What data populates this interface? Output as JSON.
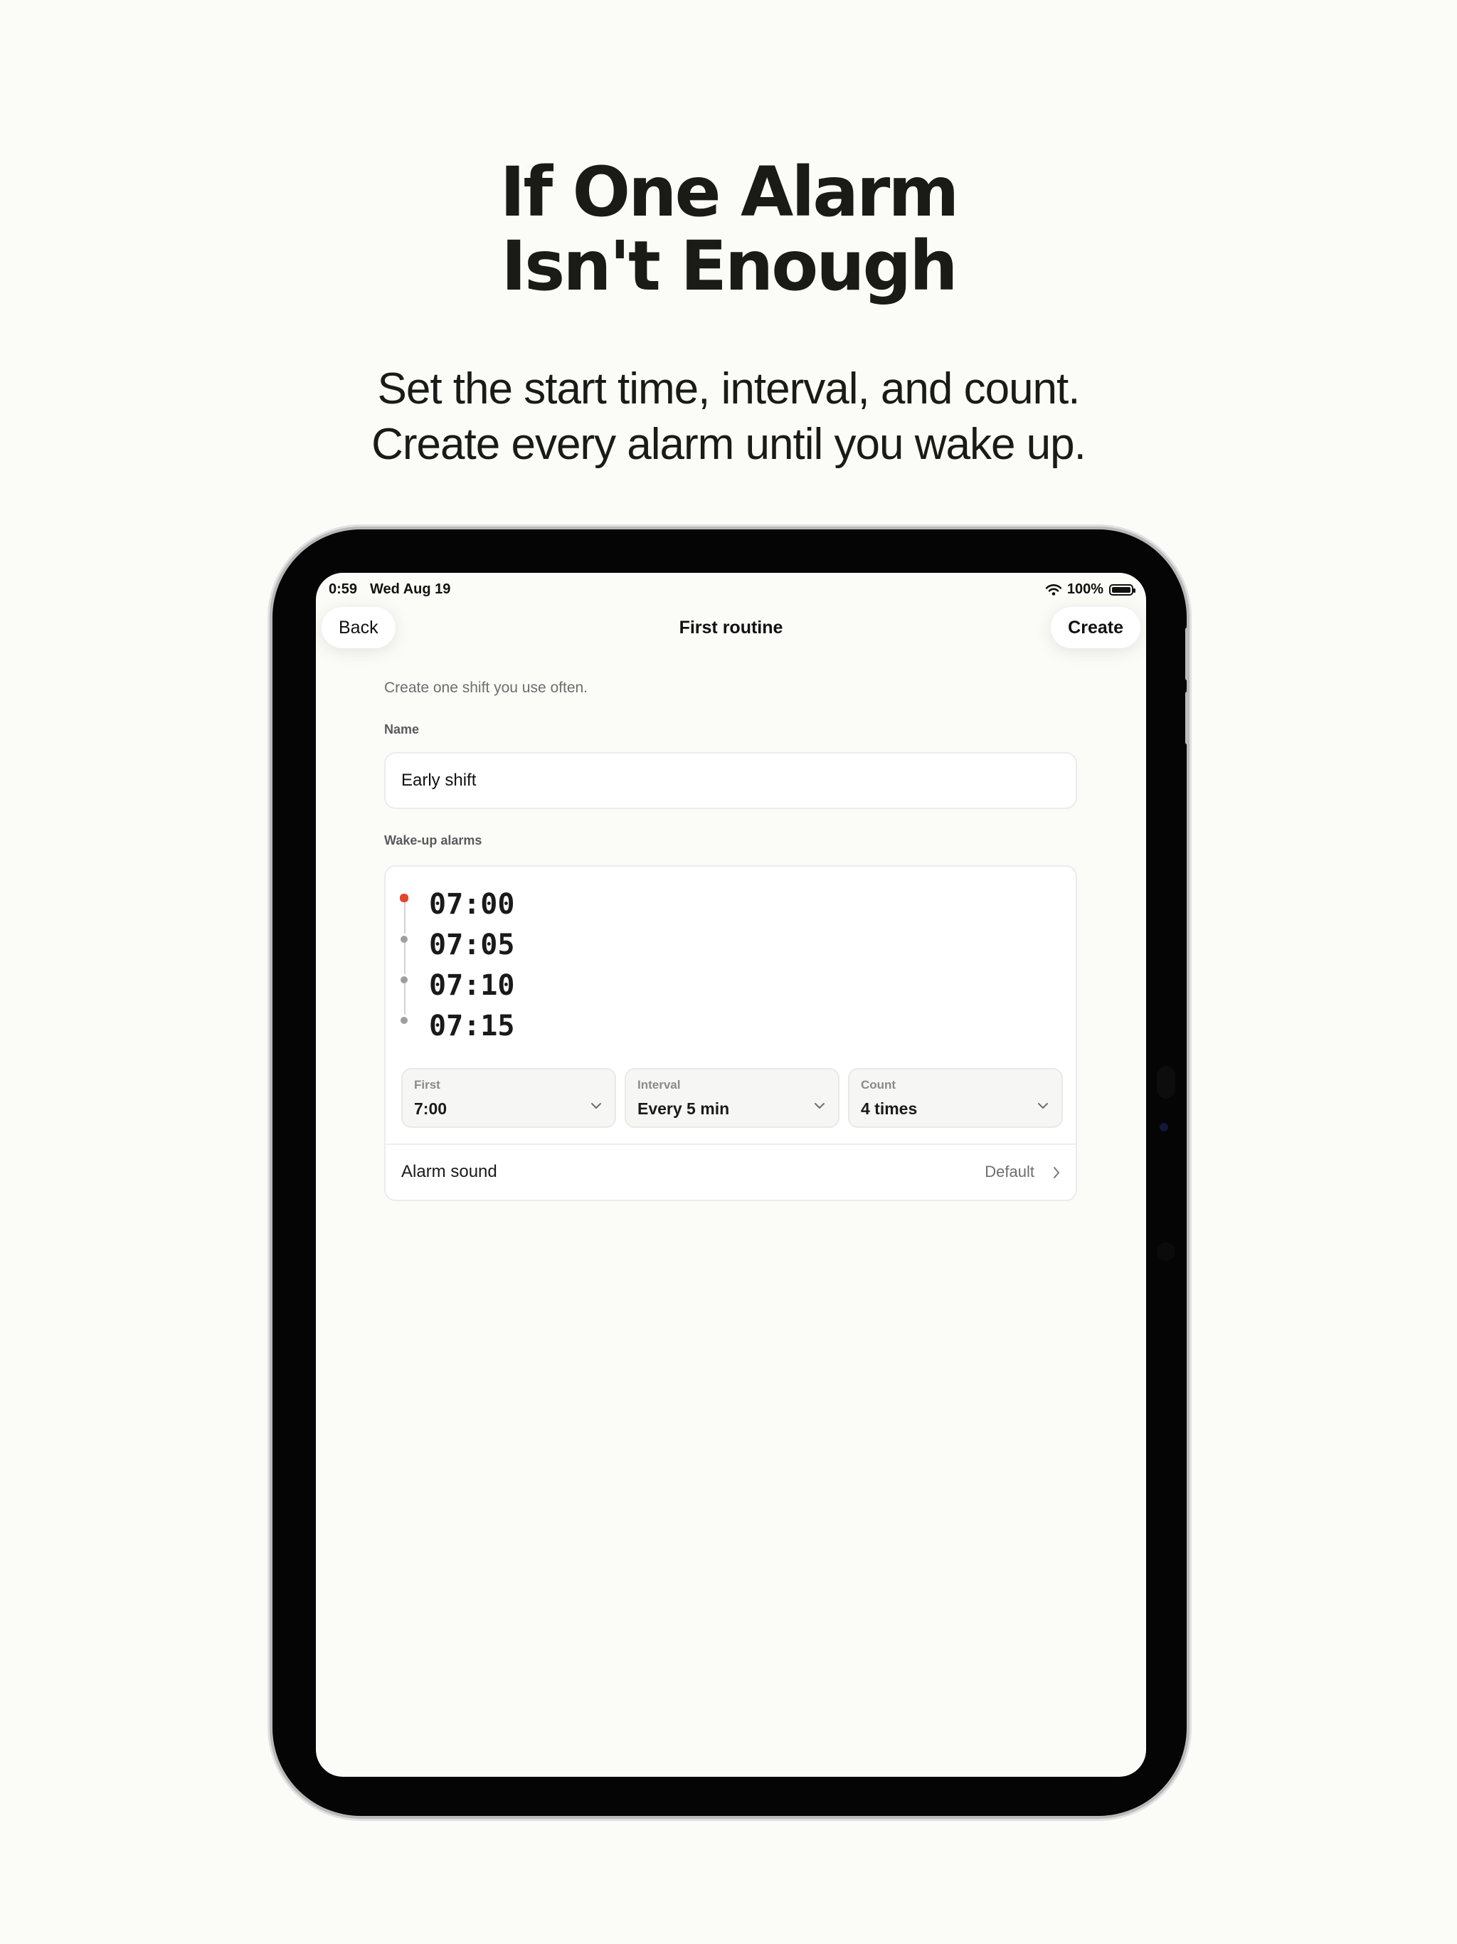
{
  "headline": {
    "line1": "If One Alarm",
    "line2": "Isn't Enough"
  },
  "subhead": {
    "line1": "Set the start time, interval, and count.",
    "line2": "Create every alarm until you wake up."
  },
  "status_bar": {
    "time": "0:59",
    "date": "Wed Aug 19",
    "battery": "100%",
    "icons": [
      "wifi-icon",
      "battery-icon"
    ]
  },
  "nav": {
    "back": "Back",
    "title": "First routine",
    "create": "Create"
  },
  "form": {
    "intro": "Create one shift you use often.",
    "name_label": "Name",
    "name_value": "Early shift",
    "alarms_label": "Wake-up alarms"
  },
  "alarms": [
    "07:00",
    "07:05",
    "07:10",
    "07:15"
  ],
  "selectors": {
    "first": {
      "label": "First",
      "value": "7:00"
    },
    "interval": {
      "label": "Interval",
      "value": "Every 5 min"
    },
    "count": {
      "label": "Count",
      "value": "4 times"
    }
  },
  "sound": {
    "label": "Alarm sound",
    "value": "Default"
  },
  "colors": {
    "background": "#fbfbf8",
    "accent": "#e5452b",
    "text": "#1a1a16",
    "device": "#050505"
  }
}
